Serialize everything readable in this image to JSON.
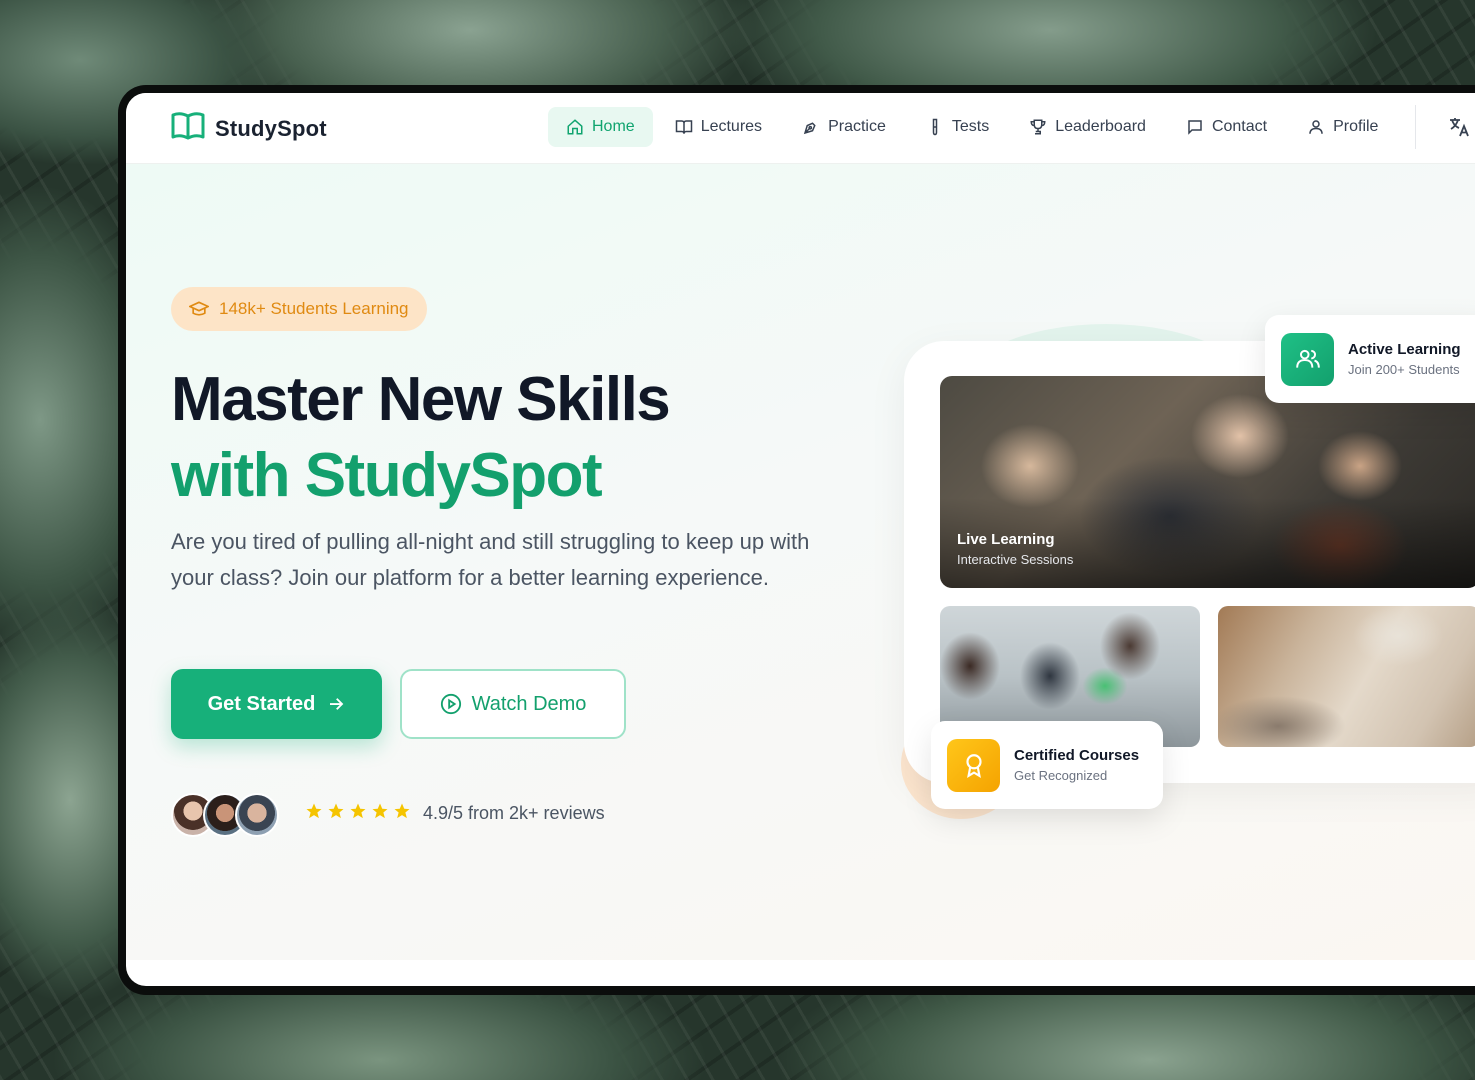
{
  "brand": {
    "name": "StudySpot",
    "accent": "#17b07a",
    "dark": "#111827"
  },
  "nav": {
    "items": [
      {
        "label": "Home",
        "icon": "home-icon",
        "active": true
      },
      {
        "label": "Lectures",
        "icon": "book-icon"
      },
      {
        "label": "Practice",
        "icon": "pen-tool-icon"
      },
      {
        "label": "Tests",
        "icon": "test-tube-icon"
      },
      {
        "label": "Leaderboard",
        "icon": "trophy-icon"
      },
      {
        "label": "Contact",
        "icon": "message-icon"
      },
      {
        "label": "Profile",
        "icon": "user-icon"
      }
    ],
    "language_icon": "translate-icon"
  },
  "hero": {
    "badge": "148k+ Students Learning",
    "title_line1": "Master New Skills",
    "title_line2": "with StudySpot",
    "description": "Are you tired of pulling all-night and still struggling to keep up with your class? Join our platform for a better learning experience.",
    "primary_button": "Get Started",
    "secondary_button": "Watch Demo",
    "rating": {
      "stars": 5,
      "text": "4.9/5 from 2k+ reviews"
    }
  },
  "gallery": {
    "main_caption_title": "Live Learning",
    "main_caption_subtitle": "Interactive Sessions"
  },
  "cards": {
    "active": {
      "title": "Active Learning",
      "subtitle": "Join 200+ Students",
      "icon": "users-icon",
      "color": "#17b07a"
    },
    "certified": {
      "title": "Certified Courses",
      "subtitle": "Get Recognized",
      "icon": "award-icon",
      "color": "#f5b400"
    }
  }
}
